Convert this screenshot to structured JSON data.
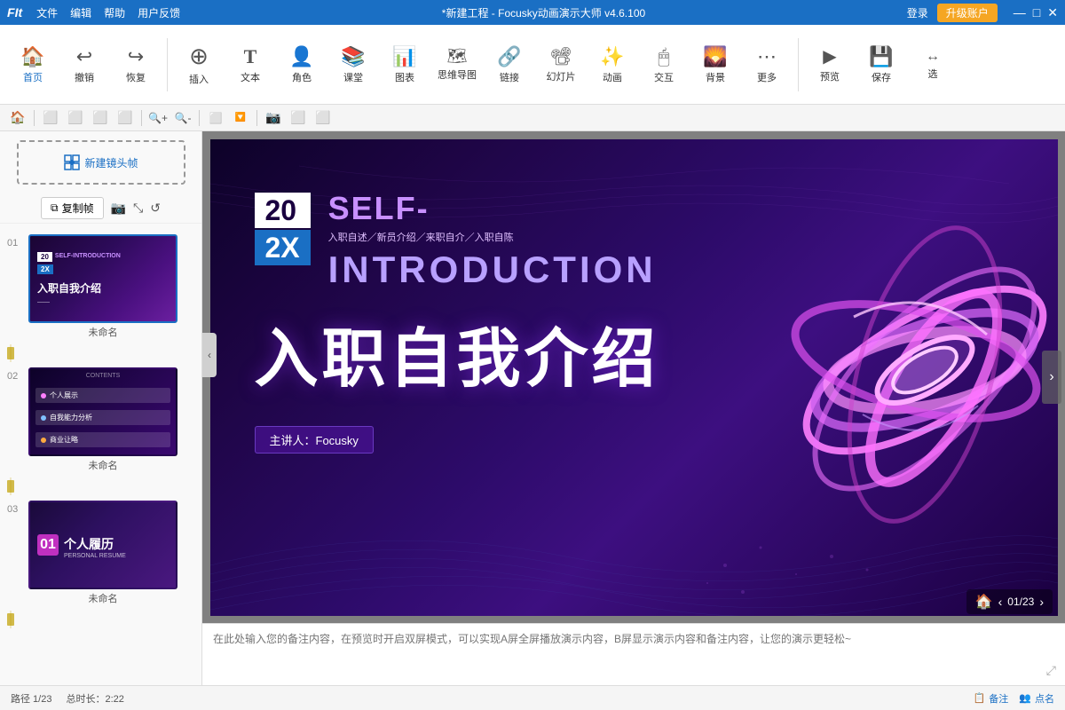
{
  "titlebar": {
    "logo": "F",
    "app_name": "FIt",
    "menus": [
      "文件",
      "编辑",
      "帮助",
      "用户反馈"
    ],
    "title": "*新建工程 - Focusky动画演示大师  v4.6.100",
    "login": "登录",
    "upgrade": "升级账户",
    "win_min": "—",
    "win_max": "□",
    "win_close": "✕"
  },
  "toolbar": {
    "groups": [
      {
        "icon": "🏠",
        "label": "首页"
      },
      {
        "icon": "↩",
        "label": "撤销"
      },
      {
        "icon": "↪",
        "label": "恢复"
      },
      {
        "sep": true
      },
      {
        "icon": "➕",
        "label": "插入"
      },
      {
        "icon": "T",
        "label": "文本"
      },
      {
        "icon": "👤",
        "label": "角色"
      },
      {
        "icon": "📚",
        "label": "课堂"
      },
      {
        "icon": "📊",
        "label": "图表"
      },
      {
        "icon": "🗺",
        "label": "思维导图"
      },
      {
        "icon": "🔗",
        "label": "链接"
      },
      {
        "icon": "📽",
        "label": "幻灯片"
      },
      {
        "icon": "✨",
        "label": "动画"
      },
      {
        "icon": "🖱",
        "label": "交互"
      },
      {
        "icon": "🌄",
        "label": "背景"
      },
      {
        "icon": "⋯",
        "label": "更多"
      },
      {
        "sep": true
      },
      {
        "icon": "▶",
        "label": "预览"
      },
      {
        "icon": "💾",
        "label": "保存"
      },
      {
        "icon": "↔",
        "label": "选"
      }
    ]
  },
  "toolbar2": {
    "icons": [
      "🏠",
      "|",
      "⬜",
      "⬜",
      "⬜",
      "⬜",
      "|",
      "🔍+",
      "🔍-",
      "|",
      "⬜",
      "🔽",
      "|",
      "📷",
      "⬜",
      "⬜"
    ]
  },
  "left_panel": {
    "new_frame_label": "新建镜头帧",
    "copy_btn": "复制帧",
    "slides": [
      {
        "num": "01",
        "name": "未命名",
        "active": true,
        "type": "intro"
      },
      {
        "num": "02",
        "name": "未命名",
        "active": false,
        "type": "menu"
      },
      {
        "num": "03",
        "name": "未命名",
        "active": false,
        "type": "resume"
      }
    ]
  },
  "slide": {
    "year_top": "20",
    "year_bottom": "2X",
    "self_label": "SELF-",
    "intro_label": "INTRODUCTION",
    "sub_tags": "入职自述／新员介绍／来职自介／入职自陈",
    "main_title": "入职自我介绍",
    "presenter": "主讲人：Focusky"
  },
  "notes": {
    "placeholder": "在此处输入您的备注内容，在预览时开启双屏模式，可以实现A屏全屏播放演示内容，B屏显示演示内容和备注内容，让您的演示更轻松~"
  },
  "status_bar": {
    "page_info": "路径 1/23",
    "total_time": "总时长：2:22",
    "note_btn": "备注",
    "roll_call_btn": "点名",
    "slide_nav": "01/23"
  }
}
